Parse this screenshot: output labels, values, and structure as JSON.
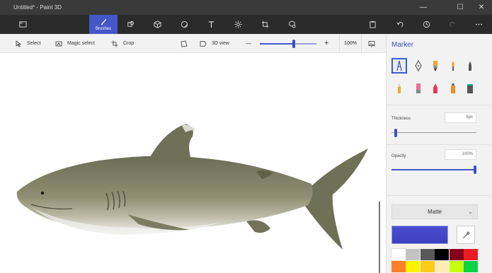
{
  "window": {
    "title": "Untitled* - Paint 3D",
    "controls": {
      "minimize": "—",
      "maximize": "☐",
      "close": "✕"
    }
  },
  "toolbar": {
    "active_label": "Brushes",
    "accent_color": "#4557c9"
  },
  "subbar": {
    "select_label": "Select",
    "magic_select_label": "Magic select",
    "crop_label": "Crop",
    "view3d_label": "3D view",
    "zoom_out": "—",
    "zoom_in": "+",
    "zoom_value": "100%",
    "zoom_level": 0.6
  },
  "panel": {
    "title": "Marker",
    "thickness_label": "Thickness",
    "thickness_value": "5px",
    "thickness_level": 0.05,
    "opacity_label": "Opacity",
    "opacity_value": "100%",
    "opacity_level": 1.0,
    "finish_value": "Matte",
    "current_color": "#3a40c0"
  },
  "palette": {
    "row1": [
      "#ffffff",
      "#c3c3c3",
      "#585858",
      "#000000",
      "#88001b",
      "#ec1c24"
    ],
    "row2": [
      "#ff7f27",
      "#fff200",
      "#ffca18",
      "#fdecb6",
      "#c4ff0e",
      "#0ed145"
    ]
  }
}
